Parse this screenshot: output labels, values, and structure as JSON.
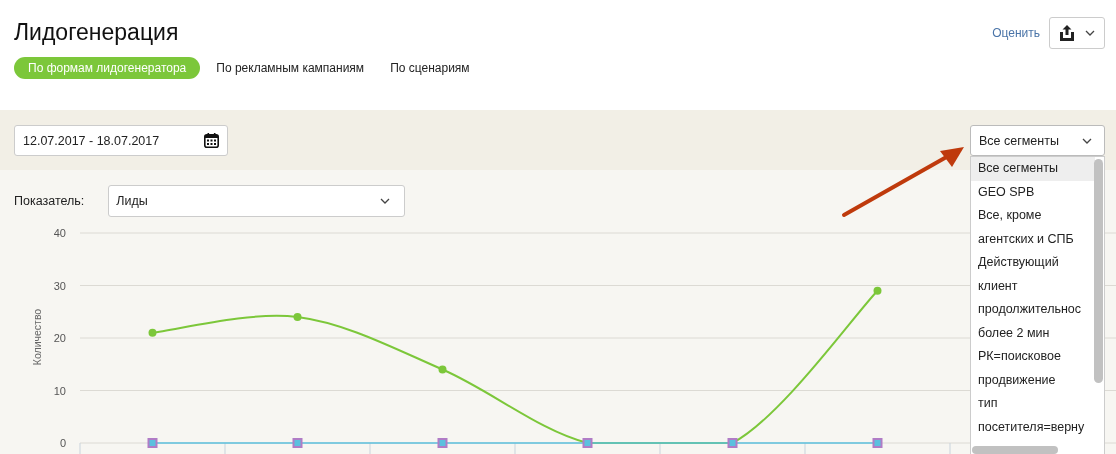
{
  "page": {
    "title": "Лидогенерация",
    "rate_link": "Оценить"
  },
  "tabs": [
    {
      "label": "По формам лидогенератора",
      "selected": true
    },
    {
      "label": "По рекламным кампаниям",
      "selected": false
    },
    {
      "label": "По сценариям",
      "selected": false
    }
  ],
  "date_range": {
    "value": "12.07.2017 - 18.07.2017"
  },
  "segments": {
    "value": "Все сегменты",
    "expanded": true,
    "options": [
      {
        "lines": [
          "Все сегменты"
        ],
        "selected": true
      },
      {
        "lines": [
          "GEO SPB"
        ],
        "selected": false
      },
      {
        "lines": [
          "Все, кроме",
          "агентских и СПБ"
        ],
        "selected": false
      },
      {
        "lines": [
          "Действующий",
          "клиент"
        ],
        "selected": false
      },
      {
        "lines": [
          "продолжительнос",
          "более 2 мин"
        ],
        "selected": false
      },
      {
        "lines": [
          "РК=поисковое",
          "продвижение"
        ],
        "selected": false
      },
      {
        "lines": [
          "тип",
          "посетителя=верну"
        ],
        "selected": false
      }
    ]
  },
  "metric": {
    "label": "Показатель:",
    "value": "Лиды"
  },
  "chart": {
    "chart_data": {
      "type": "line",
      "ylabel": "Количество",
      "ylim": [
        0,
        40
      ],
      "yticks": [
        0,
        10,
        20,
        30,
        40
      ],
      "grid": true,
      "series": [
        {
          "color": "#7cc73a",
          "marker": "circle",
          "values": [
            21,
            24,
            14,
            0,
            0,
            29,
            null
          ]
        },
        {
          "color": "#5bc0de",
          "marker": "square",
          "values": [
            0,
            0,
            0,
            0,
            0,
            0,
            null
          ]
        }
      ]
    }
  }
}
